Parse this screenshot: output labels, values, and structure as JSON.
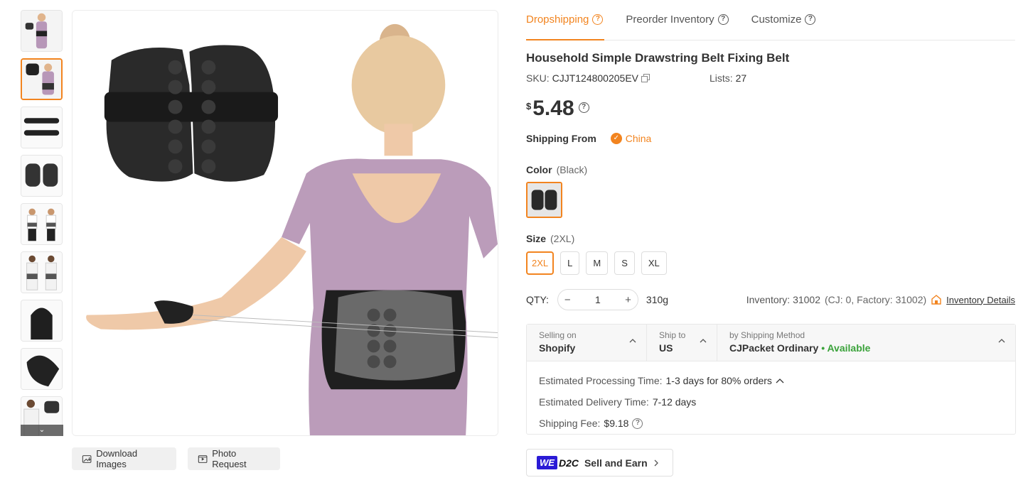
{
  "thumbnails": [
    {
      "name": "thumb-model-front"
    },
    {
      "name": "thumb-model-back"
    },
    {
      "name": "thumb-belt-strips"
    },
    {
      "name": "thumb-belt-flat"
    },
    {
      "name": "thumb-men-wearing"
    },
    {
      "name": "thumb-man-front-back"
    },
    {
      "name": "thumb-pad-detail"
    },
    {
      "name": "thumb-pad-closeup"
    },
    {
      "name": "thumb-man-partial"
    }
  ],
  "image_actions": {
    "download_label": "Download Images",
    "photo_request_label": "Photo Request"
  },
  "tabs": [
    {
      "label": "Dropshipping",
      "active": true
    },
    {
      "label": "Preorder Inventory",
      "active": false
    },
    {
      "label": "Customize",
      "active": false
    }
  ],
  "product": {
    "title": "Household Simple Drawstring Belt Fixing Belt",
    "sku_label": "SKU:",
    "sku": "CJJT124800205EV",
    "lists_label": "Lists:",
    "lists": "27",
    "currency": "$",
    "price": "5.48"
  },
  "shipping_from": {
    "label": "Shipping From",
    "value": "China"
  },
  "color": {
    "label": "Color",
    "selected": "(Black)"
  },
  "size": {
    "label": "Size",
    "selected": "(2XL)",
    "options": [
      "2XL",
      "L",
      "M",
      "S",
      "XL"
    ]
  },
  "qty": {
    "label": "QTY:",
    "value": "1",
    "weight": "310g",
    "inventory": "Inventory: 31002",
    "inventory_detail": "(CJ: 0, Factory: 31002)",
    "inventory_link": "Inventory Details"
  },
  "shipping": {
    "selling_label": "Selling on",
    "selling_value": "Shopify",
    "ship_to_label": "Ship to",
    "ship_to_value": "US",
    "method_label": "by Shipping Method",
    "method_value": "CJPacket Ordinary",
    "availability": "• Available",
    "processing_label": "Estimated Processing Time:",
    "processing_value": "1-3 days for 80% orders",
    "delivery_label": "Estimated Delivery Time:",
    "delivery_value": "7-12 days",
    "fee_label": "Shipping Fee:",
    "fee_value": "$9.18"
  },
  "promo": {
    "we": "WE",
    "d2c": "D2C",
    "label": "Sell and Earn"
  },
  "colors": {
    "accent": "#f2841f",
    "available": "#3aa23a",
    "we_brand": "#2b1bd6"
  }
}
